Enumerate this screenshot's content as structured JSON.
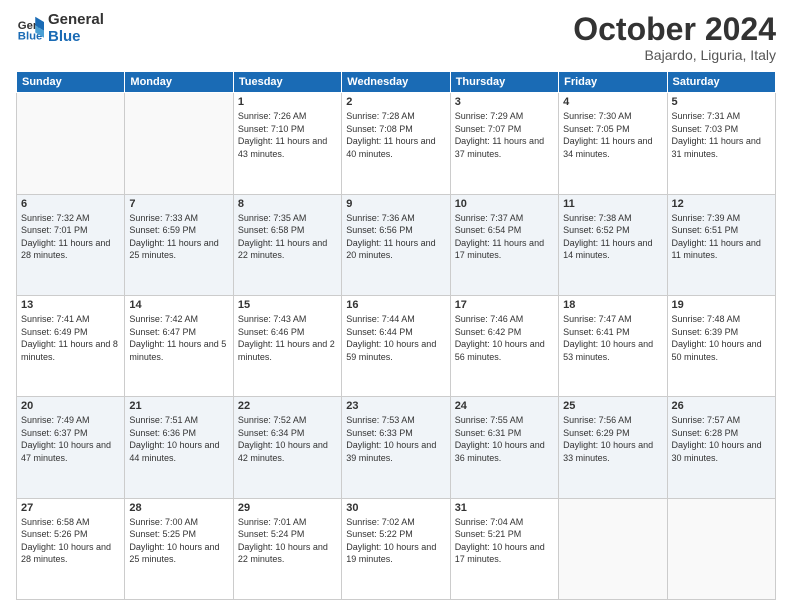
{
  "logo": {
    "line1": "General",
    "line2": "Blue"
  },
  "header": {
    "month": "October 2024",
    "location": "Bajardo, Liguria, Italy"
  },
  "weekdays": [
    "Sunday",
    "Monday",
    "Tuesday",
    "Wednesday",
    "Thursday",
    "Friday",
    "Saturday"
  ],
  "weeks": [
    [
      {
        "day": "",
        "sunrise": "",
        "sunset": "",
        "daylight": ""
      },
      {
        "day": "",
        "sunrise": "",
        "sunset": "",
        "daylight": ""
      },
      {
        "day": "1",
        "sunrise": "Sunrise: 7:26 AM",
        "sunset": "Sunset: 7:10 PM",
        "daylight": "Daylight: 11 hours and 43 minutes."
      },
      {
        "day": "2",
        "sunrise": "Sunrise: 7:28 AM",
        "sunset": "Sunset: 7:08 PM",
        "daylight": "Daylight: 11 hours and 40 minutes."
      },
      {
        "day": "3",
        "sunrise": "Sunrise: 7:29 AM",
        "sunset": "Sunset: 7:07 PM",
        "daylight": "Daylight: 11 hours and 37 minutes."
      },
      {
        "day": "4",
        "sunrise": "Sunrise: 7:30 AM",
        "sunset": "Sunset: 7:05 PM",
        "daylight": "Daylight: 11 hours and 34 minutes."
      },
      {
        "day": "5",
        "sunrise": "Sunrise: 7:31 AM",
        "sunset": "Sunset: 7:03 PM",
        "daylight": "Daylight: 11 hours and 31 minutes."
      }
    ],
    [
      {
        "day": "6",
        "sunrise": "Sunrise: 7:32 AM",
        "sunset": "Sunset: 7:01 PM",
        "daylight": "Daylight: 11 hours and 28 minutes."
      },
      {
        "day": "7",
        "sunrise": "Sunrise: 7:33 AM",
        "sunset": "Sunset: 6:59 PM",
        "daylight": "Daylight: 11 hours and 25 minutes."
      },
      {
        "day": "8",
        "sunrise": "Sunrise: 7:35 AM",
        "sunset": "Sunset: 6:58 PM",
        "daylight": "Daylight: 11 hours and 22 minutes."
      },
      {
        "day": "9",
        "sunrise": "Sunrise: 7:36 AM",
        "sunset": "Sunset: 6:56 PM",
        "daylight": "Daylight: 11 hours and 20 minutes."
      },
      {
        "day": "10",
        "sunrise": "Sunrise: 7:37 AM",
        "sunset": "Sunset: 6:54 PM",
        "daylight": "Daylight: 11 hours and 17 minutes."
      },
      {
        "day": "11",
        "sunrise": "Sunrise: 7:38 AM",
        "sunset": "Sunset: 6:52 PM",
        "daylight": "Daylight: 11 hours and 14 minutes."
      },
      {
        "day": "12",
        "sunrise": "Sunrise: 7:39 AM",
        "sunset": "Sunset: 6:51 PM",
        "daylight": "Daylight: 11 hours and 11 minutes."
      }
    ],
    [
      {
        "day": "13",
        "sunrise": "Sunrise: 7:41 AM",
        "sunset": "Sunset: 6:49 PM",
        "daylight": "Daylight: 11 hours and 8 minutes."
      },
      {
        "day": "14",
        "sunrise": "Sunrise: 7:42 AM",
        "sunset": "Sunset: 6:47 PM",
        "daylight": "Daylight: 11 hours and 5 minutes."
      },
      {
        "day": "15",
        "sunrise": "Sunrise: 7:43 AM",
        "sunset": "Sunset: 6:46 PM",
        "daylight": "Daylight: 11 hours and 2 minutes."
      },
      {
        "day": "16",
        "sunrise": "Sunrise: 7:44 AM",
        "sunset": "Sunset: 6:44 PM",
        "daylight": "Daylight: 10 hours and 59 minutes."
      },
      {
        "day": "17",
        "sunrise": "Sunrise: 7:46 AM",
        "sunset": "Sunset: 6:42 PM",
        "daylight": "Daylight: 10 hours and 56 minutes."
      },
      {
        "day": "18",
        "sunrise": "Sunrise: 7:47 AM",
        "sunset": "Sunset: 6:41 PM",
        "daylight": "Daylight: 10 hours and 53 minutes."
      },
      {
        "day": "19",
        "sunrise": "Sunrise: 7:48 AM",
        "sunset": "Sunset: 6:39 PM",
        "daylight": "Daylight: 10 hours and 50 minutes."
      }
    ],
    [
      {
        "day": "20",
        "sunrise": "Sunrise: 7:49 AM",
        "sunset": "Sunset: 6:37 PM",
        "daylight": "Daylight: 10 hours and 47 minutes."
      },
      {
        "day": "21",
        "sunrise": "Sunrise: 7:51 AM",
        "sunset": "Sunset: 6:36 PM",
        "daylight": "Daylight: 10 hours and 44 minutes."
      },
      {
        "day": "22",
        "sunrise": "Sunrise: 7:52 AM",
        "sunset": "Sunset: 6:34 PM",
        "daylight": "Daylight: 10 hours and 42 minutes."
      },
      {
        "day": "23",
        "sunrise": "Sunrise: 7:53 AM",
        "sunset": "Sunset: 6:33 PM",
        "daylight": "Daylight: 10 hours and 39 minutes."
      },
      {
        "day": "24",
        "sunrise": "Sunrise: 7:55 AM",
        "sunset": "Sunset: 6:31 PM",
        "daylight": "Daylight: 10 hours and 36 minutes."
      },
      {
        "day": "25",
        "sunrise": "Sunrise: 7:56 AM",
        "sunset": "Sunset: 6:29 PM",
        "daylight": "Daylight: 10 hours and 33 minutes."
      },
      {
        "day": "26",
        "sunrise": "Sunrise: 7:57 AM",
        "sunset": "Sunset: 6:28 PM",
        "daylight": "Daylight: 10 hours and 30 minutes."
      }
    ],
    [
      {
        "day": "27",
        "sunrise": "Sunrise: 6:58 AM",
        "sunset": "Sunset: 5:26 PM",
        "daylight": "Daylight: 10 hours and 28 minutes."
      },
      {
        "day": "28",
        "sunrise": "Sunrise: 7:00 AM",
        "sunset": "Sunset: 5:25 PM",
        "daylight": "Daylight: 10 hours and 25 minutes."
      },
      {
        "day": "29",
        "sunrise": "Sunrise: 7:01 AM",
        "sunset": "Sunset: 5:24 PM",
        "daylight": "Daylight: 10 hours and 22 minutes."
      },
      {
        "day": "30",
        "sunrise": "Sunrise: 7:02 AM",
        "sunset": "Sunset: 5:22 PM",
        "daylight": "Daylight: 10 hours and 19 minutes."
      },
      {
        "day": "31",
        "sunrise": "Sunrise: 7:04 AM",
        "sunset": "Sunset: 5:21 PM",
        "daylight": "Daylight: 10 hours and 17 minutes."
      },
      {
        "day": "",
        "sunrise": "",
        "sunset": "",
        "daylight": ""
      },
      {
        "day": "",
        "sunrise": "",
        "sunset": "",
        "daylight": ""
      }
    ]
  ]
}
